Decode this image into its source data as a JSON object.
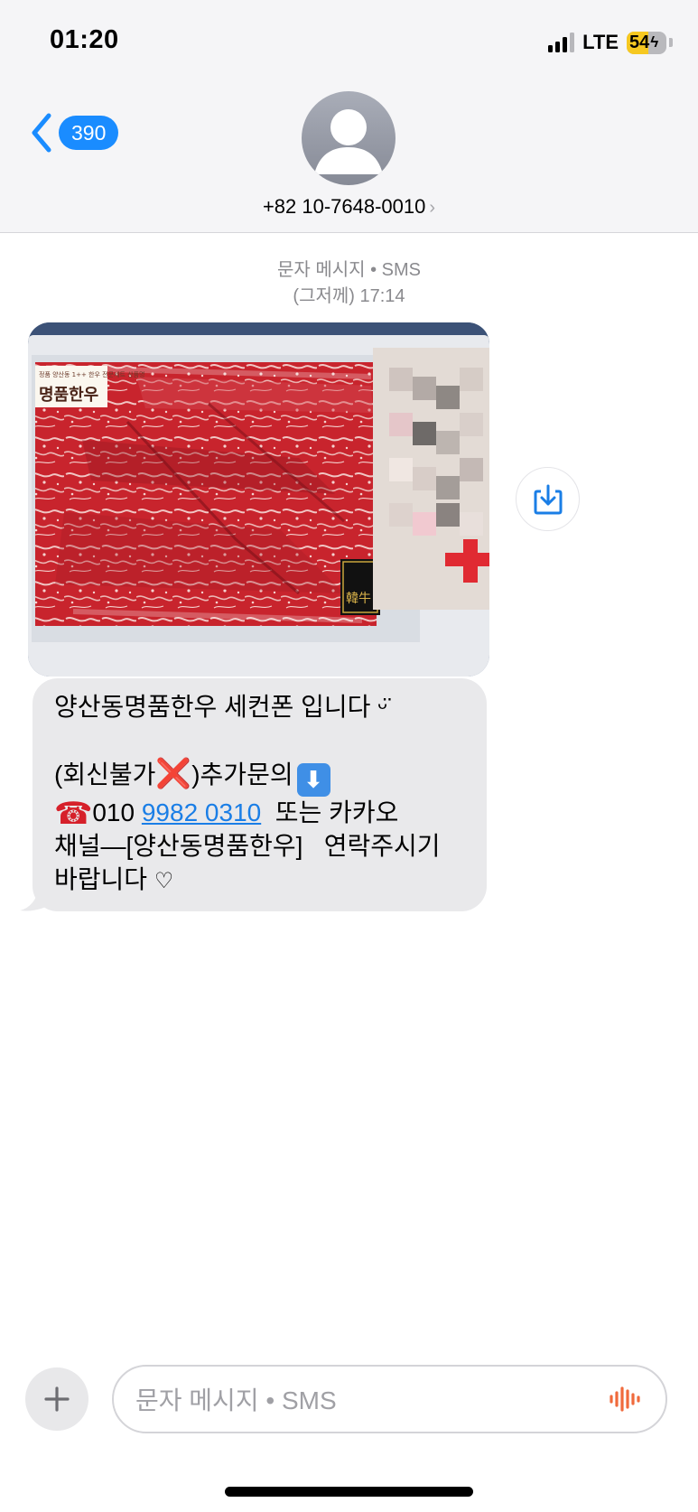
{
  "status_bar": {
    "time": "01:20",
    "network": "LTE",
    "battery": "54",
    "battery_level": 54
  },
  "header": {
    "back_count": "390",
    "contact_number": "+82 10-7648-0010",
    "contact_chevron": "›"
  },
  "conversation": {
    "channel_label": "문자 메시지 • SMS",
    "timestamp": "(그저께) 17:14",
    "message": {
      "line1": "양산동명품한우 세컨폰 입니다 ᵕ̈",
      "line3_pre": "(회신불가",
      "line3_x": "❌",
      "line3_post": ")추가문의",
      "line3_arrow": "⬇",
      "line4_tel": "☎",
      "line4_prefix": "010 ",
      "line4_link": "9982 0310",
      "line4_post": "  또는 카카오",
      "line5": "채널—[양산동명품한우]   연락주시기",
      "line6": "바랍니다",
      "heart": "♡"
    },
    "image": {
      "label_box": "명품한우",
      "label_small": "정품 양산동 1++ 한우 전문세트 상품명",
      "badge": "韓牛"
    }
  },
  "composer": {
    "placeholder": "문자 메시지 • SMS"
  },
  "colors": {
    "accent": "#1a8cff",
    "bubble": "#e9e9eb",
    "header_bg": "#f5f5f7",
    "battery": "#f6c821"
  },
  "icons": [
    "back-chevron-icon",
    "avatar-icon",
    "save-to-photos-icon",
    "plus-icon",
    "audio-waveform-icon"
  ]
}
